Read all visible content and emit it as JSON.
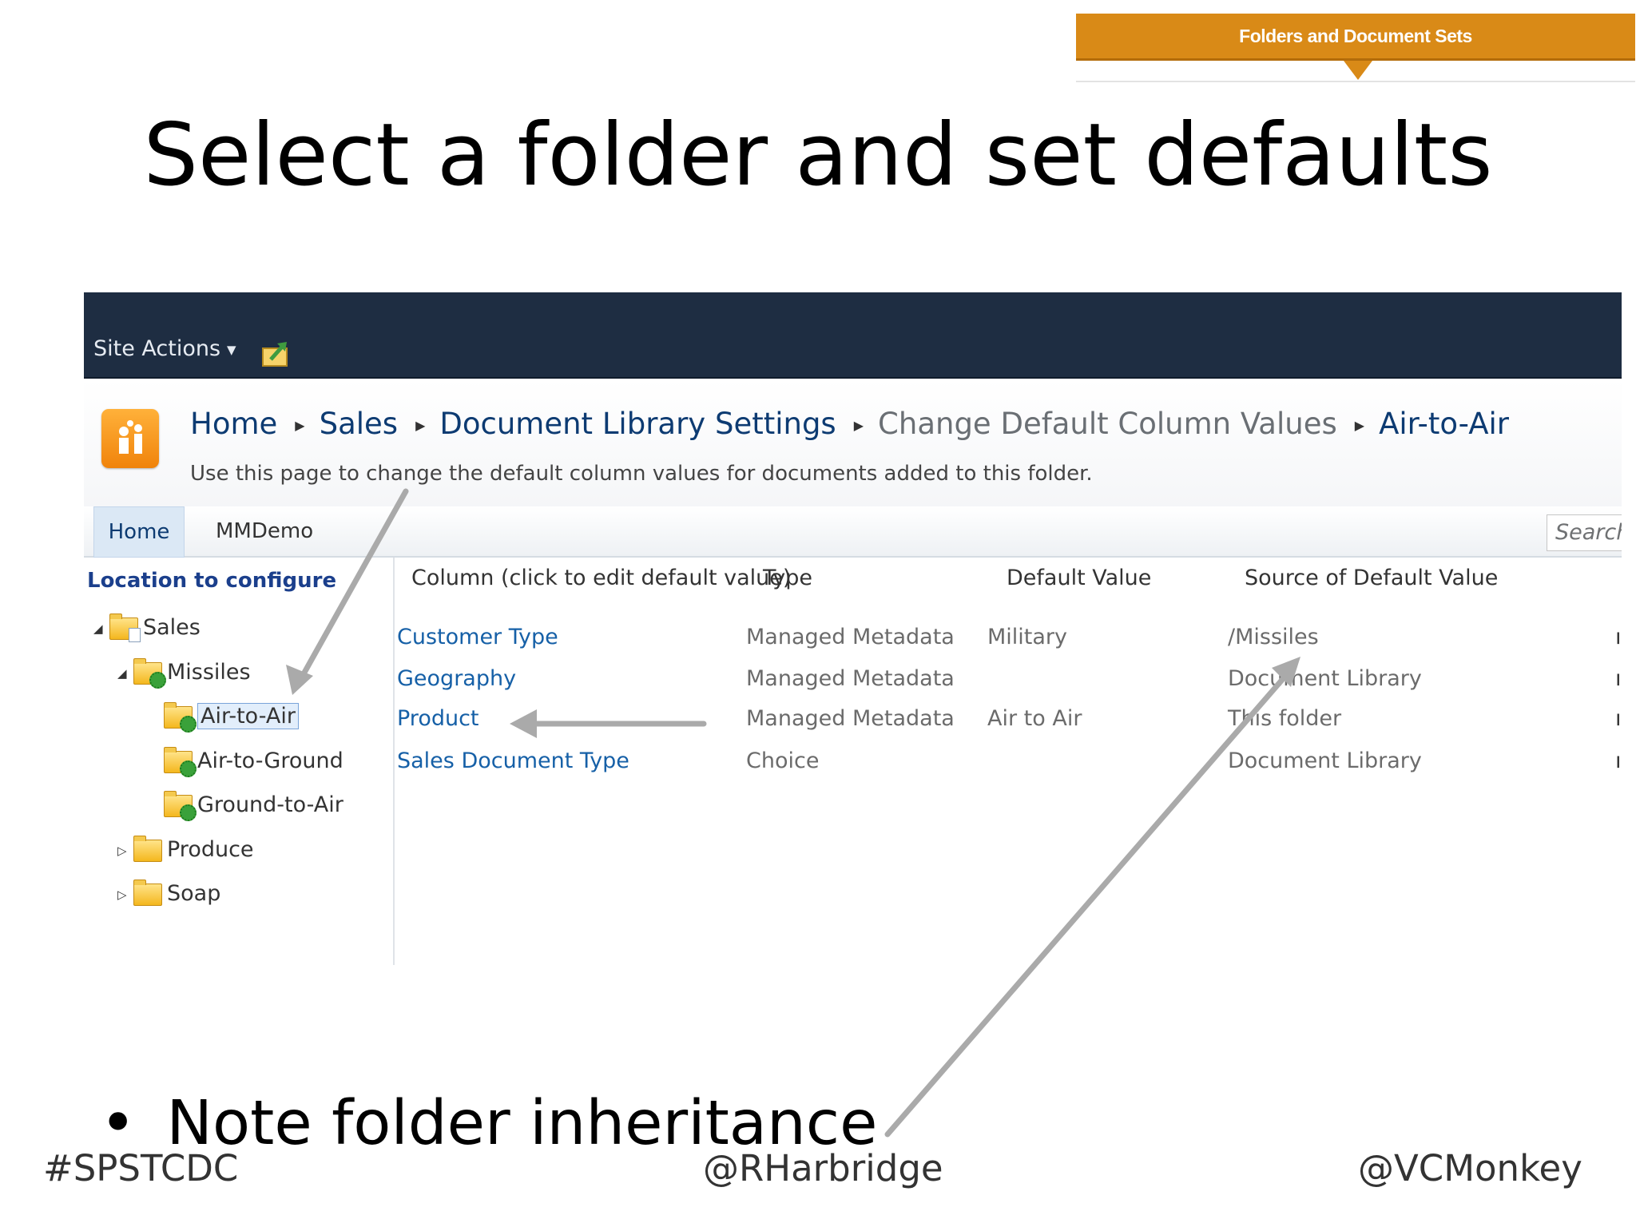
{
  "banner": {
    "label": "Folders and Document Sets"
  },
  "slide": {
    "title": "Select a folder and set defaults",
    "bullet": "Note folder inheritance",
    "footer": {
      "left": "#SPSTCDC",
      "center": "@RHarbridge",
      "right": "@VCMonkey"
    }
  },
  "ribbon": {
    "site_actions": "Site Actions"
  },
  "header": {
    "breadcrumb": [
      "Home",
      "Sales",
      "Document Library Settings",
      "Change Default Column Values",
      "Air-to-Air"
    ],
    "description": "Use this page to change the default column values for documents added to this folder."
  },
  "topnav": {
    "tabs": [
      "Home",
      "MMDemo"
    ],
    "search_placeholder": "Search"
  },
  "left_panel": {
    "title": "Location to configure",
    "tree": [
      "Sales",
      "Missiles",
      "Air-to-Air",
      "Air-to-Ground",
      "Ground-to-Air",
      "Produce",
      "Soap"
    ]
  },
  "grid": {
    "columns": [
      "Column (click to edit default value)",
      "Type",
      "Default Value",
      "Source of Default Value"
    ],
    "rows": [
      {
        "column": "Customer Type",
        "type": "Managed Metadata",
        "default": "Military",
        "source": "/Missiles"
      },
      {
        "column": "Geography",
        "type": "Managed Metadata",
        "default": "",
        "source": "Document Library"
      },
      {
        "column": "Product",
        "type": "Managed Metadata",
        "default": "Air to Air",
        "source": "This folder"
      },
      {
        "column": "Sales Document Type",
        "type": "Choice",
        "default": "",
        "source": "Document Library"
      }
    ]
  },
  "colors": {
    "banner": "#d98a17",
    "ribbon": "#1e2d42",
    "link": "#1660a7",
    "annotation_arrow": "#aaaaaa"
  }
}
